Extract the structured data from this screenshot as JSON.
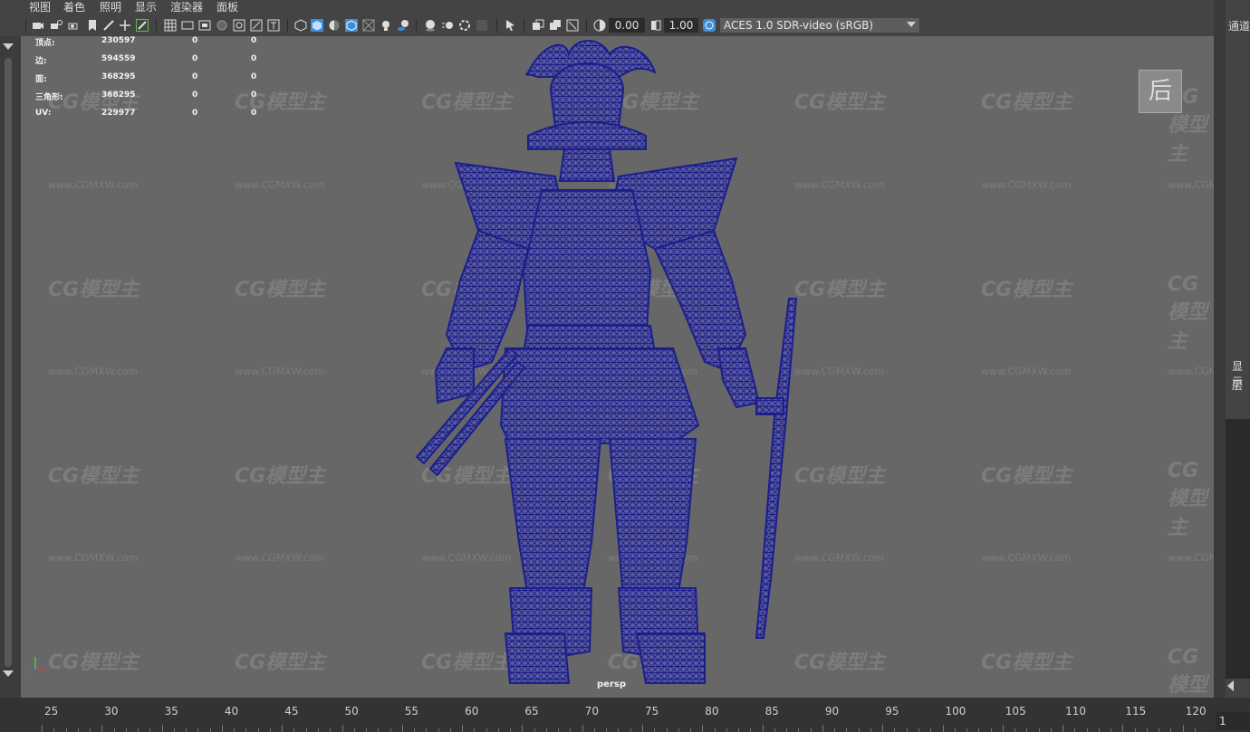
{
  "menu": {
    "items": [
      "视图",
      "着色",
      "照明",
      "显示",
      "渲染器",
      "面板"
    ]
  },
  "toolbar": {
    "exposure": "0.00",
    "gamma": "1.00",
    "color_space": "ACES 1.0 SDR-video (sRGB)",
    "icons": [
      "camera-icon",
      "camera-attributes-icon",
      "bookmark-icon",
      "image-plane-icon",
      "grid-icon",
      "film-gate-icon",
      "resolution-gate-icon",
      "gate-mask-icon",
      "field-chart-icon",
      "safe-action-icon",
      "safe-title-icon",
      "wireframe-icon",
      "smooth-shade-icon",
      "default-material-icon",
      "shaded-wireframe-icon",
      "xray-icon",
      "use-all-lights-icon",
      "shadows-icon",
      "screen-space-ao-icon",
      "motion-blur-icon",
      "multisample-aa-icon",
      "depth-of-field-icon",
      "isolate-select-icon",
      "xray-joints-icon",
      "xray-active-icon",
      "backface-culling-icon",
      "exposure-icon",
      "gamma-icon",
      "color-management-icon"
    ]
  },
  "hud": {
    "rows": [
      {
        "label": "顶点:",
        "total": "230597",
        "selected": "0",
        "uv": "0"
      },
      {
        "label": "边:",
        "total": "594559",
        "selected": "0",
        "uv": "0"
      },
      {
        "label": "面:",
        "total": "368295",
        "selected": "0",
        "uv": "0"
      },
      {
        "label": "三角形:",
        "total": "368295",
        "selected": "0",
        "uv": "0"
      },
      {
        "label": "UV:",
        "total": "229977",
        "selected": "0",
        "uv": "0"
      }
    ]
  },
  "viewport": {
    "camera_label": "persp",
    "view_cube_label": "后",
    "wireframe_color": "#1c1e8c",
    "background_color": "#676767",
    "watermark_logo": "CG模型主",
    "watermark_url": "www.CGMXW.com"
  },
  "right_panel": {
    "tab_channels": "通道",
    "tab_display": "显示",
    "tab_layers": "层"
  },
  "timeline": {
    "ticks": [
      "25",
      "30",
      "35",
      "40",
      "45",
      "50",
      "55",
      "60",
      "65",
      "70",
      "75",
      "80",
      "85",
      "90",
      "95",
      "100",
      "105",
      "110",
      "115",
      "120"
    ],
    "current_frame": "1"
  }
}
